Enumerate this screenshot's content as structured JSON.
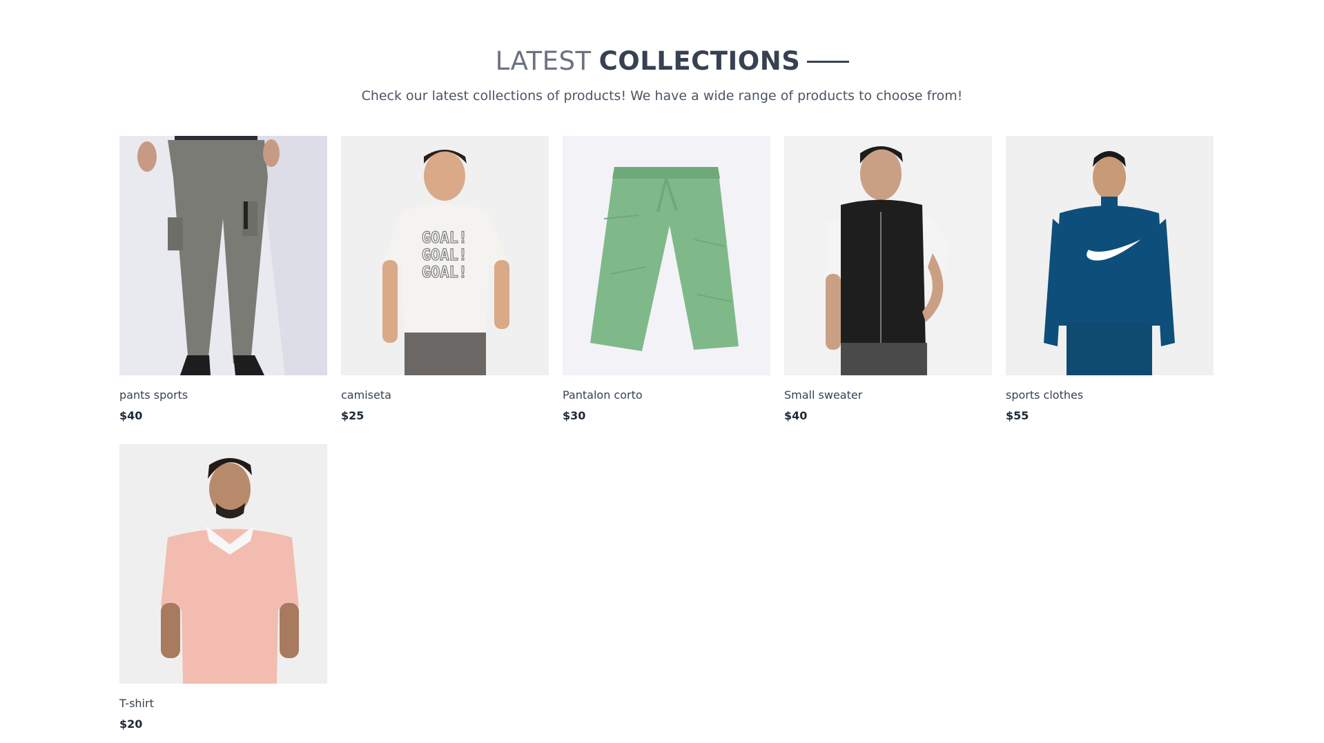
{
  "header": {
    "title_light": "LATEST",
    "title_bold": "COLLECTIONS",
    "subtitle": "Check our latest collections of products! We have a wide range of products to choose from!"
  },
  "products": [
    {
      "name": "pants sports",
      "price": "$40",
      "image": "man-in-grey-cargo-joggers",
      "bg": "#e9eaef"
    },
    {
      "name": "camiseta",
      "price": "$25",
      "image": "boy-in-white-goal-tshirt",
      "bg": "#f0f0f0"
    },
    {
      "name": "Pantalon corto",
      "price": "$30",
      "image": "green-crinkle-pants",
      "bg": "#f3f2f6"
    },
    {
      "name": "Small sweater",
      "price": "$40",
      "image": "man-in-black-hooded-vest",
      "bg": "#f2f2f2"
    },
    {
      "name": "sports clothes",
      "price": "$55",
      "image": "woman-in-blue-track-jacket",
      "bg": "#f0f0f0"
    },
    {
      "name": "T-shirt",
      "price": "$20",
      "image": "man-in-pink-polo-shirt",
      "bg": "#efefef"
    }
  ],
  "colors": {
    "title_light": "#6b7280",
    "title_bold": "#374151",
    "text": "#374151"
  }
}
